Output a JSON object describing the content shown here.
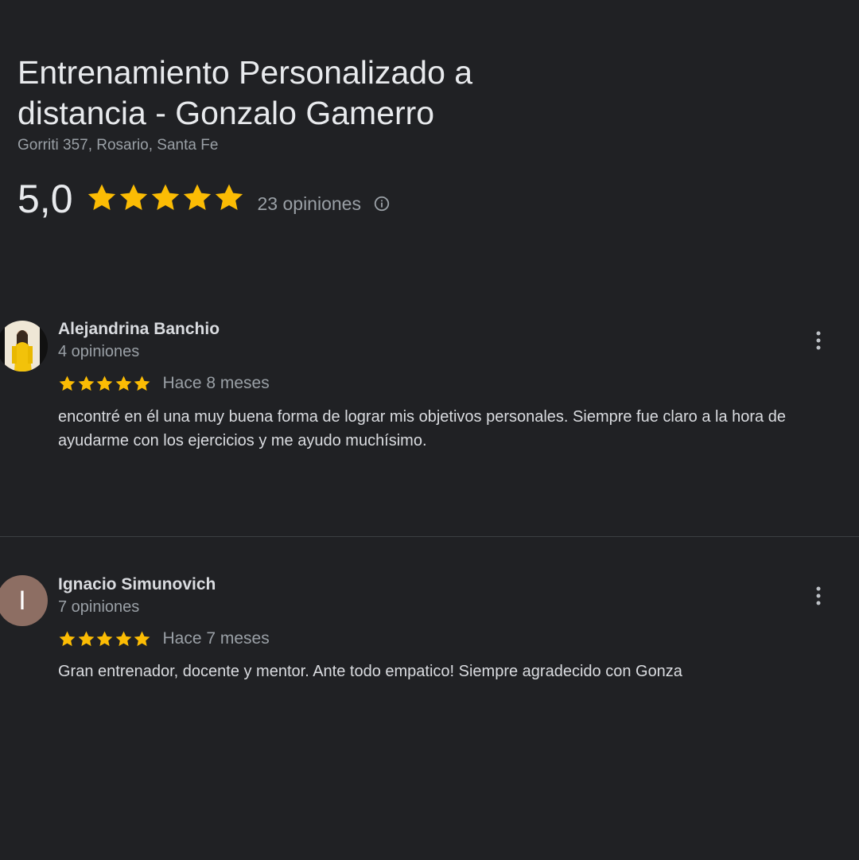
{
  "business": {
    "name": "Entrenamiento Personalizado a distancia - Gonzalo Gamerro",
    "address": "Gorriti 357, Rosario, Santa Fe",
    "rating": "5,0",
    "stars": 5,
    "review_count": "23 opiniones",
    "info_icon": "info-icon"
  },
  "reviews": [
    {
      "author": "Alejandrina Banchio",
      "author_reviews": "4 opiniones",
      "stars": 5,
      "time": "Hace 8 meses",
      "text": "encontré en él una muy buena forma de lograr mis objetivos personales. Siempre fue claro a la hora de ayudarme con los ejercicios y me ayudo muchísimo.",
      "avatar_type": "photo"
    },
    {
      "author": "Ignacio Simunovich",
      "author_reviews": "7 opiniones",
      "stars": 5,
      "time": "Hace 7 meses",
      "text": "Gran entrenador, docente y mentor. Ante todo empatico! Siempre agradecido con Gonza",
      "avatar_type": "letter",
      "avatar_letter": "I",
      "avatar_color": "#8d6e63"
    }
  ],
  "colors": {
    "background": "#202124",
    "star": "#fbbc04",
    "primary_text": "#e8eaed",
    "secondary_text": "#9aa0a6"
  }
}
